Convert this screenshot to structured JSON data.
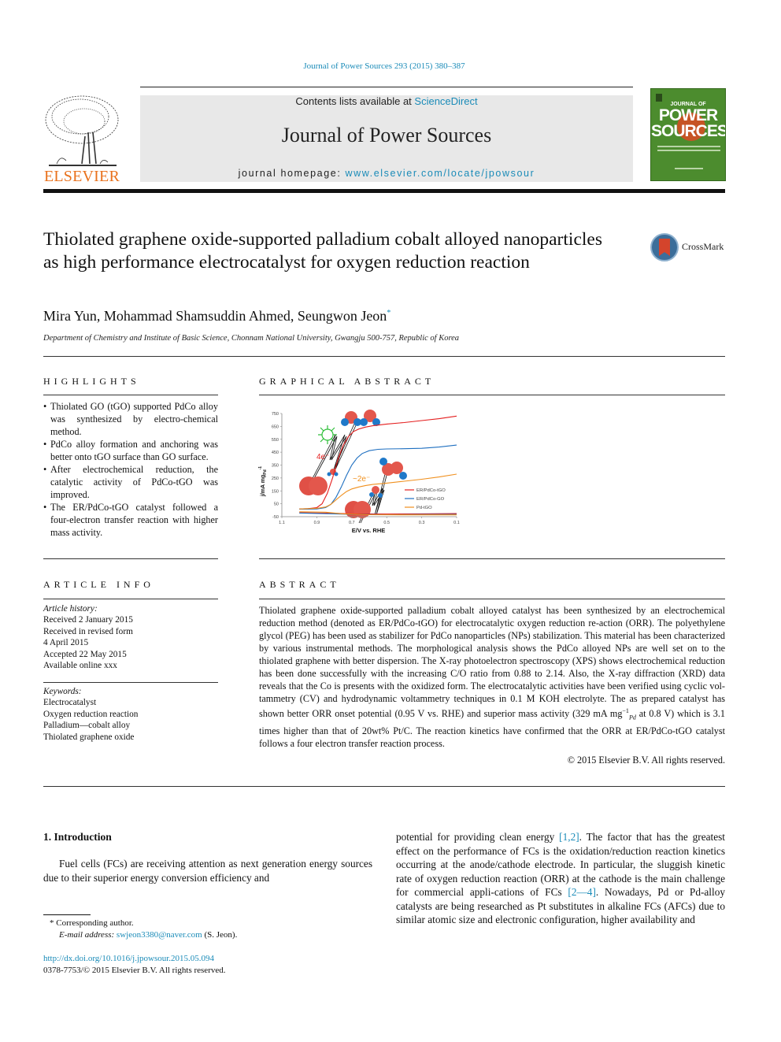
{
  "header": {
    "citation": "Journal of Power Sources 293 (2015) 380–387",
    "contents_prefix": "Contents lists available at ",
    "contents_link": "ScienceDirect",
    "journal_title": "Journal of Power Sources",
    "homepage_prefix": "journal homepage: ",
    "homepage_link": "www.elsevier.com/locate/jpowsour",
    "publisher": "ELSEVIER",
    "cover": {
      "line1": "JOURNAL OF",
      "line2": "POWER",
      "line3": "SOURCES",
      "bg_color": "#4c8c2e"
    }
  },
  "article": {
    "title": "Thiolated graphene oxide-supported palladium cobalt alloyed nanoparticles as high performance electrocatalyst for oxygen reduction reaction",
    "crossmark": "CrossMark",
    "authors": "Mira Yun, Mohammad Shamsuddin Ahmed, Seungwon Jeon",
    "corresponding_mark": "*",
    "affiliation": "Department of Chemistry and Institute of Basic Science, Chonnam National University, Gwangju 500-757, Republic of Korea"
  },
  "highlights": {
    "heading": "HIGHLIGHTS",
    "items": [
      "Thiolated GO (tGO) supported PdCo alloy was synthesized by electro-chemical method.",
      "PdCo alloy formation and anchoring was better onto tGO surface than GO surface.",
      "After electrochemical reduction, the catalytic activity of PdCo-tGO was improved.",
      "The ER/PdCo-tGO catalyst followed a four-electron transfer reaction with higher mass activity."
    ]
  },
  "graphical_abstract": {
    "heading": "GRAPHICAL ABSTRACT"
  },
  "article_info": {
    "heading": "ARTICLE INFO",
    "history_label": "Article history:",
    "history": [
      "Received 2 January 2015",
      "Received in revised form",
      "4 April 2015",
      "Accepted 22 May 2015",
      "Available online xxx"
    ],
    "keywords_label": "Keywords:",
    "keywords": [
      "Electrocatalyst",
      "Oxygen reduction reaction",
      "Palladium—cobalt alloy",
      "Thiolated graphene oxide"
    ]
  },
  "abstract": {
    "heading": "ABSTRACT",
    "text_1": "Thiolated graphene oxide-supported palladium cobalt alloyed catalyst has been synthesized by an electrochemical reduction method (denoted as ER/PdCo-tGO) for electrocatalytic oxygen reduction re-action (ORR). The polyethylene glycol (PEG) has been used as stabilizer for PdCo nanoparticles (NPs) stabilization. This material has been characterized by various instrumental methods. The morphological analysis shows the PdCo alloyed NPs are well set on to the thiolated graphene with better dispersion. The X-ray photoelectron spectroscopy (XPS) shows electrochemical reduction has been done successfully with the increasing C/O ratio from 0.88 to 2.14. Also, the X-ray diffraction (XRD) data reveals that the Co is presents with the oxidized form. The electrocatalytic activities have been verified using cyclic vol-tammetry (CV) and hydrodynamic voltammetry techniques in 0.1 M KOH electrolyte. The as prepared catalyst has shown better ORR onset potential (0.95 V vs. RHE) and superior mass activity (329 mA mg",
    "unit_sup": "−1",
    "unit_sub": "Pd",
    "text_2": "at 0.8 V) which is 3.1 times higher than that of 20wt% Pt/C. The reaction kinetics have confirmed that the ORR at ER/PdCo-tGO catalyst follows a four electron transfer reaction process.",
    "copyright": "© 2015 Elsevier B.V. All rights reserved."
  },
  "introduction": {
    "heading": "1.  Introduction",
    "left_text": "Fuel cells (FCs) are receiving attention as next generation energy sources due to their superior energy conversion efficiency and",
    "right_text_1": "potential for providing clean energy ",
    "ref_1": "[1,2]",
    "right_text_2": ". The factor that has the greatest effect on the performance of FCs is the oxidation/reduction reaction kinetics occurring at the anode/cathode electrode. In particular, the sluggish kinetic rate of oxygen reduction reaction (ORR) at the cathode is the main challenge for commercial appli-cations of FCs ",
    "ref_2": "[2—4]",
    "right_text_3": ". Nowadays, Pd or Pd-alloy catalysts are being researched as Pt substitutes in alkaline FCs (AFCs) due to similar atomic size and electronic configuration, higher availability and"
  },
  "footnote": {
    "corresponding": "*  Corresponding author.",
    "email_label": "E-mail address: ",
    "email": "swjeon3380@naver.com",
    "email_suffix": " (S. Jeon).",
    "doi": "http://dx.doi.org/10.1016/j.jpowsour.2015.05.094",
    "issn": "0378-7753/© 2015 Elsevier B.V. All rights reserved."
  },
  "chart_data": {
    "type": "line",
    "title": "",
    "xlabel": "E/V vs. RHE",
    "ylabel": "j/mA mg_Pd^-1",
    "xlim": [
      1.1,
      0.1
    ],
    "ylim": [
      -50,
      750
    ],
    "x_ticks": [
      "1.1",
      "0.9",
      "0.7",
      "0.5",
      "0.3",
      "0.1"
    ],
    "y_ticks": [
      "750",
      "650",
      "550",
      "450",
      "350",
      "250",
      "150",
      "50",
      "-50"
    ],
    "grid": false,
    "legend_position": "bottom-right",
    "annotations": [
      "4e⁻",
      "~2e⁻"
    ],
    "series": [
      {
        "name": "ER/PdCo-tGO",
        "color": "#e41e1e",
        "x": [
          1.0,
          0.95,
          0.9,
          0.87,
          0.84,
          0.81,
          0.78,
          0.75,
          0.72,
          0.69,
          0.66,
          0.62,
          0.58,
          0.5,
          0.4,
          0.3,
          0.2,
          0.1
        ],
        "y": [
          10,
          12,
          20,
          50,
          130,
          250,
          390,
          500,
          570,
          610,
          630,
          645,
          655,
          668,
          680,
          695,
          710,
          730
        ]
      },
      {
        "name": "ER/PdCo-GO",
        "color": "#1e6fc0",
        "x": [
          1.0,
          0.95,
          0.9,
          0.85,
          0.82,
          0.79,
          0.76,
          0.73,
          0.7,
          0.67,
          0.64,
          0.6,
          0.55,
          0.5,
          0.4,
          0.3,
          0.2,
          0.1
        ],
        "y": [
          8,
          8,
          10,
          20,
          45,
          100,
          180,
          270,
          350,
          405,
          440,
          462,
          472,
          475,
          477,
          480,
          490,
          505
        ]
      },
      {
        "name": "Pd-tGO",
        "color": "#f0901e",
        "x": [
          1.0,
          0.95,
          0.9,
          0.85,
          0.82,
          0.79,
          0.76,
          0.73,
          0.7,
          0.66,
          0.62,
          0.58,
          0.5,
          0.4,
          0.3,
          0.2,
          0.1
        ],
        "y": [
          10,
          12,
          15,
          25,
          45,
          80,
          115,
          145,
          165,
          180,
          192,
          200,
          210,
          225,
          240,
          258,
          280
        ]
      },
      {
        "name": "ER/PdCo-tGO (ring)",
        "color": "#e41e1e",
        "x": [
          1.0,
          0.8,
          0.7,
          0.5,
          0.3,
          0.1
        ],
        "y": [
          -20,
          -24,
          -28,
          -30,
          -28,
          -26
        ]
      },
      {
        "name": "ER/PdCo-GO (ring)",
        "color": "#1e6fc0",
        "x": [
          1.0,
          0.8,
          0.7,
          0.5,
          0.3,
          0.1
        ],
        "y": [
          -22,
          -28,
          -32,
          -35,
          -33,
          -32
        ]
      },
      {
        "name": "Pd-tGO (ring)",
        "color": "#f0901e",
        "x": [
          1.0,
          0.85,
          0.75,
          0.6,
          0.4,
          0.1
        ],
        "y": [
          -12,
          -15,
          -28,
          -35,
          -36,
          -36
        ]
      }
    ]
  }
}
